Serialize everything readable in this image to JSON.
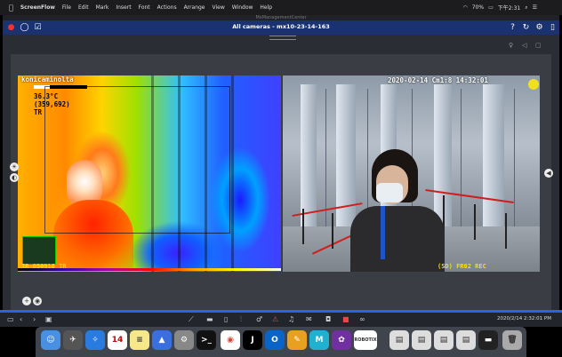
{
  "menubar": {
    "app": "ScreenFlow",
    "items": [
      "File",
      "Edit",
      "Mark",
      "Insert",
      "Font",
      "Actions",
      "Arrange",
      "View",
      "Window",
      "Help"
    ],
    "battery": "70%",
    "clock": "下午2:31"
  },
  "window": {
    "app_title": "MxManagementCenter",
    "camera_title": "All cameras - mx10-23-14-163"
  },
  "thermal": {
    "brand": "konicaminolta",
    "temperature": "36.3°C",
    "coords": "(359,692)",
    "mode": "TR",
    "footer": "TR 050918 TR"
  },
  "visible": {
    "timestamp": "2020-02-14 Cm1:8 14:32:01",
    "footer": "(SD) FR02 REC"
  },
  "bottom": {
    "timestamp": "2020/2/14 2:32:01 PM"
  },
  "dock": {
    "calendar_day": "14",
    "robotix": "ROBOTIX"
  },
  "colors": {
    "toolbar": "#1a3270",
    "accent": "#1f6ae0"
  }
}
